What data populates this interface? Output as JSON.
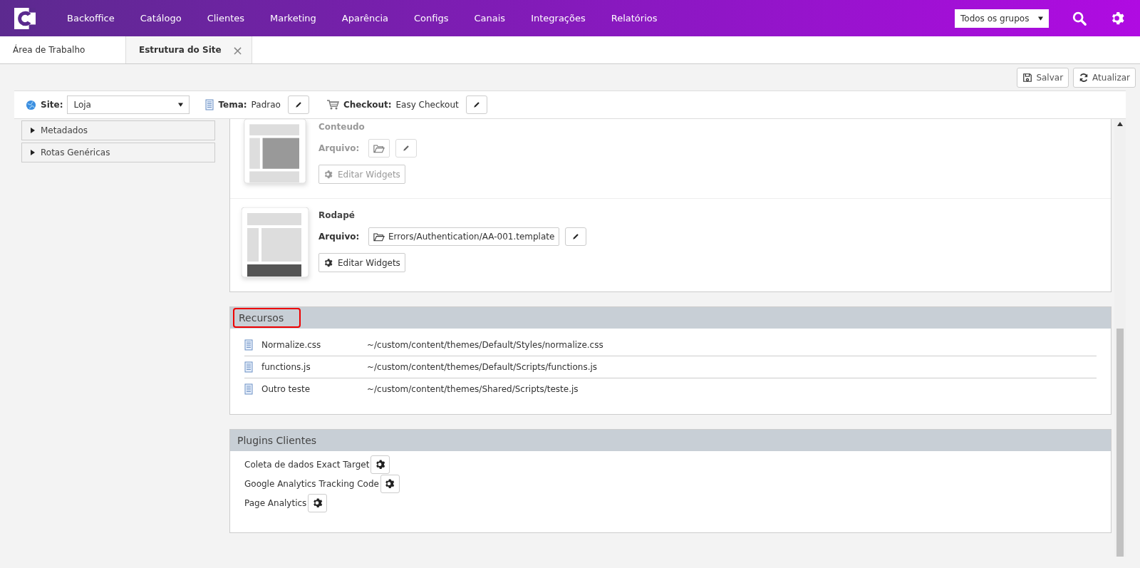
{
  "nav": {
    "items": [
      "Backoffice",
      "Catálogo",
      "Clientes",
      "Marketing",
      "Aparência",
      "Configs",
      "Canais",
      "Integrações",
      "Relatórios"
    ],
    "group_select": "Todos os grupos"
  },
  "tabs": [
    {
      "label": "Área de Trabalho",
      "selected": false,
      "closable": false
    },
    {
      "label": "Estrutura do Site",
      "selected": true,
      "closable": true
    }
  ],
  "close_glyph": "×",
  "actions": [
    "Salvar",
    "Atualizar"
  ],
  "toolbar": {
    "site_label": "Site:",
    "site_value": "Loja",
    "theme_label": "Tema:",
    "theme_value": "Padrao",
    "checkout_label": "Checkout:",
    "checkout_value": "Easy Checkout"
  },
  "sidebar": {
    "items": [
      {
        "label": "Metadados",
        "expanded": false
      },
      {
        "label": "Rotas Genéricas",
        "expanded": false
      }
    ]
  },
  "layout_sections": [
    {
      "title": "Conteudo",
      "kind": "content",
      "disabled": true,
      "file_label": "Arquivo:",
      "widgets_button": "Editar Widgets"
    },
    {
      "title": "Rodapé",
      "kind": "footer",
      "disabled": false,
      "file_label": "Arquivo:",
      "file": "Errors/Authentication/AA-001.template",
      "widgets_button": "Editar Widgets"
    }
  ],
  "resources": {
    "title": "Recursos",
    "highlighted": true,
    "rows": [
      {
        "name": "Normalize.css",
        "path": "~/custom/content/themes/Default/Styles/normalize.css"
      },
      {
        "name": "functions.js",
        "path": "~/custom/content/themes/Default/Scripts/functions.js"
      },
      {
        "name": "Outro teste",
        "path": "~/custom/content/themes/Shared/Scripts/teste.js"
      }
    ]
  },
  "plugins": {
    "title": "Plugins Clientes",
    "items": [
      "Coleta de dados Exact Target",
      "Google Analytics Tracking Code",
      "Page Analytics"
    ]
  }
}
